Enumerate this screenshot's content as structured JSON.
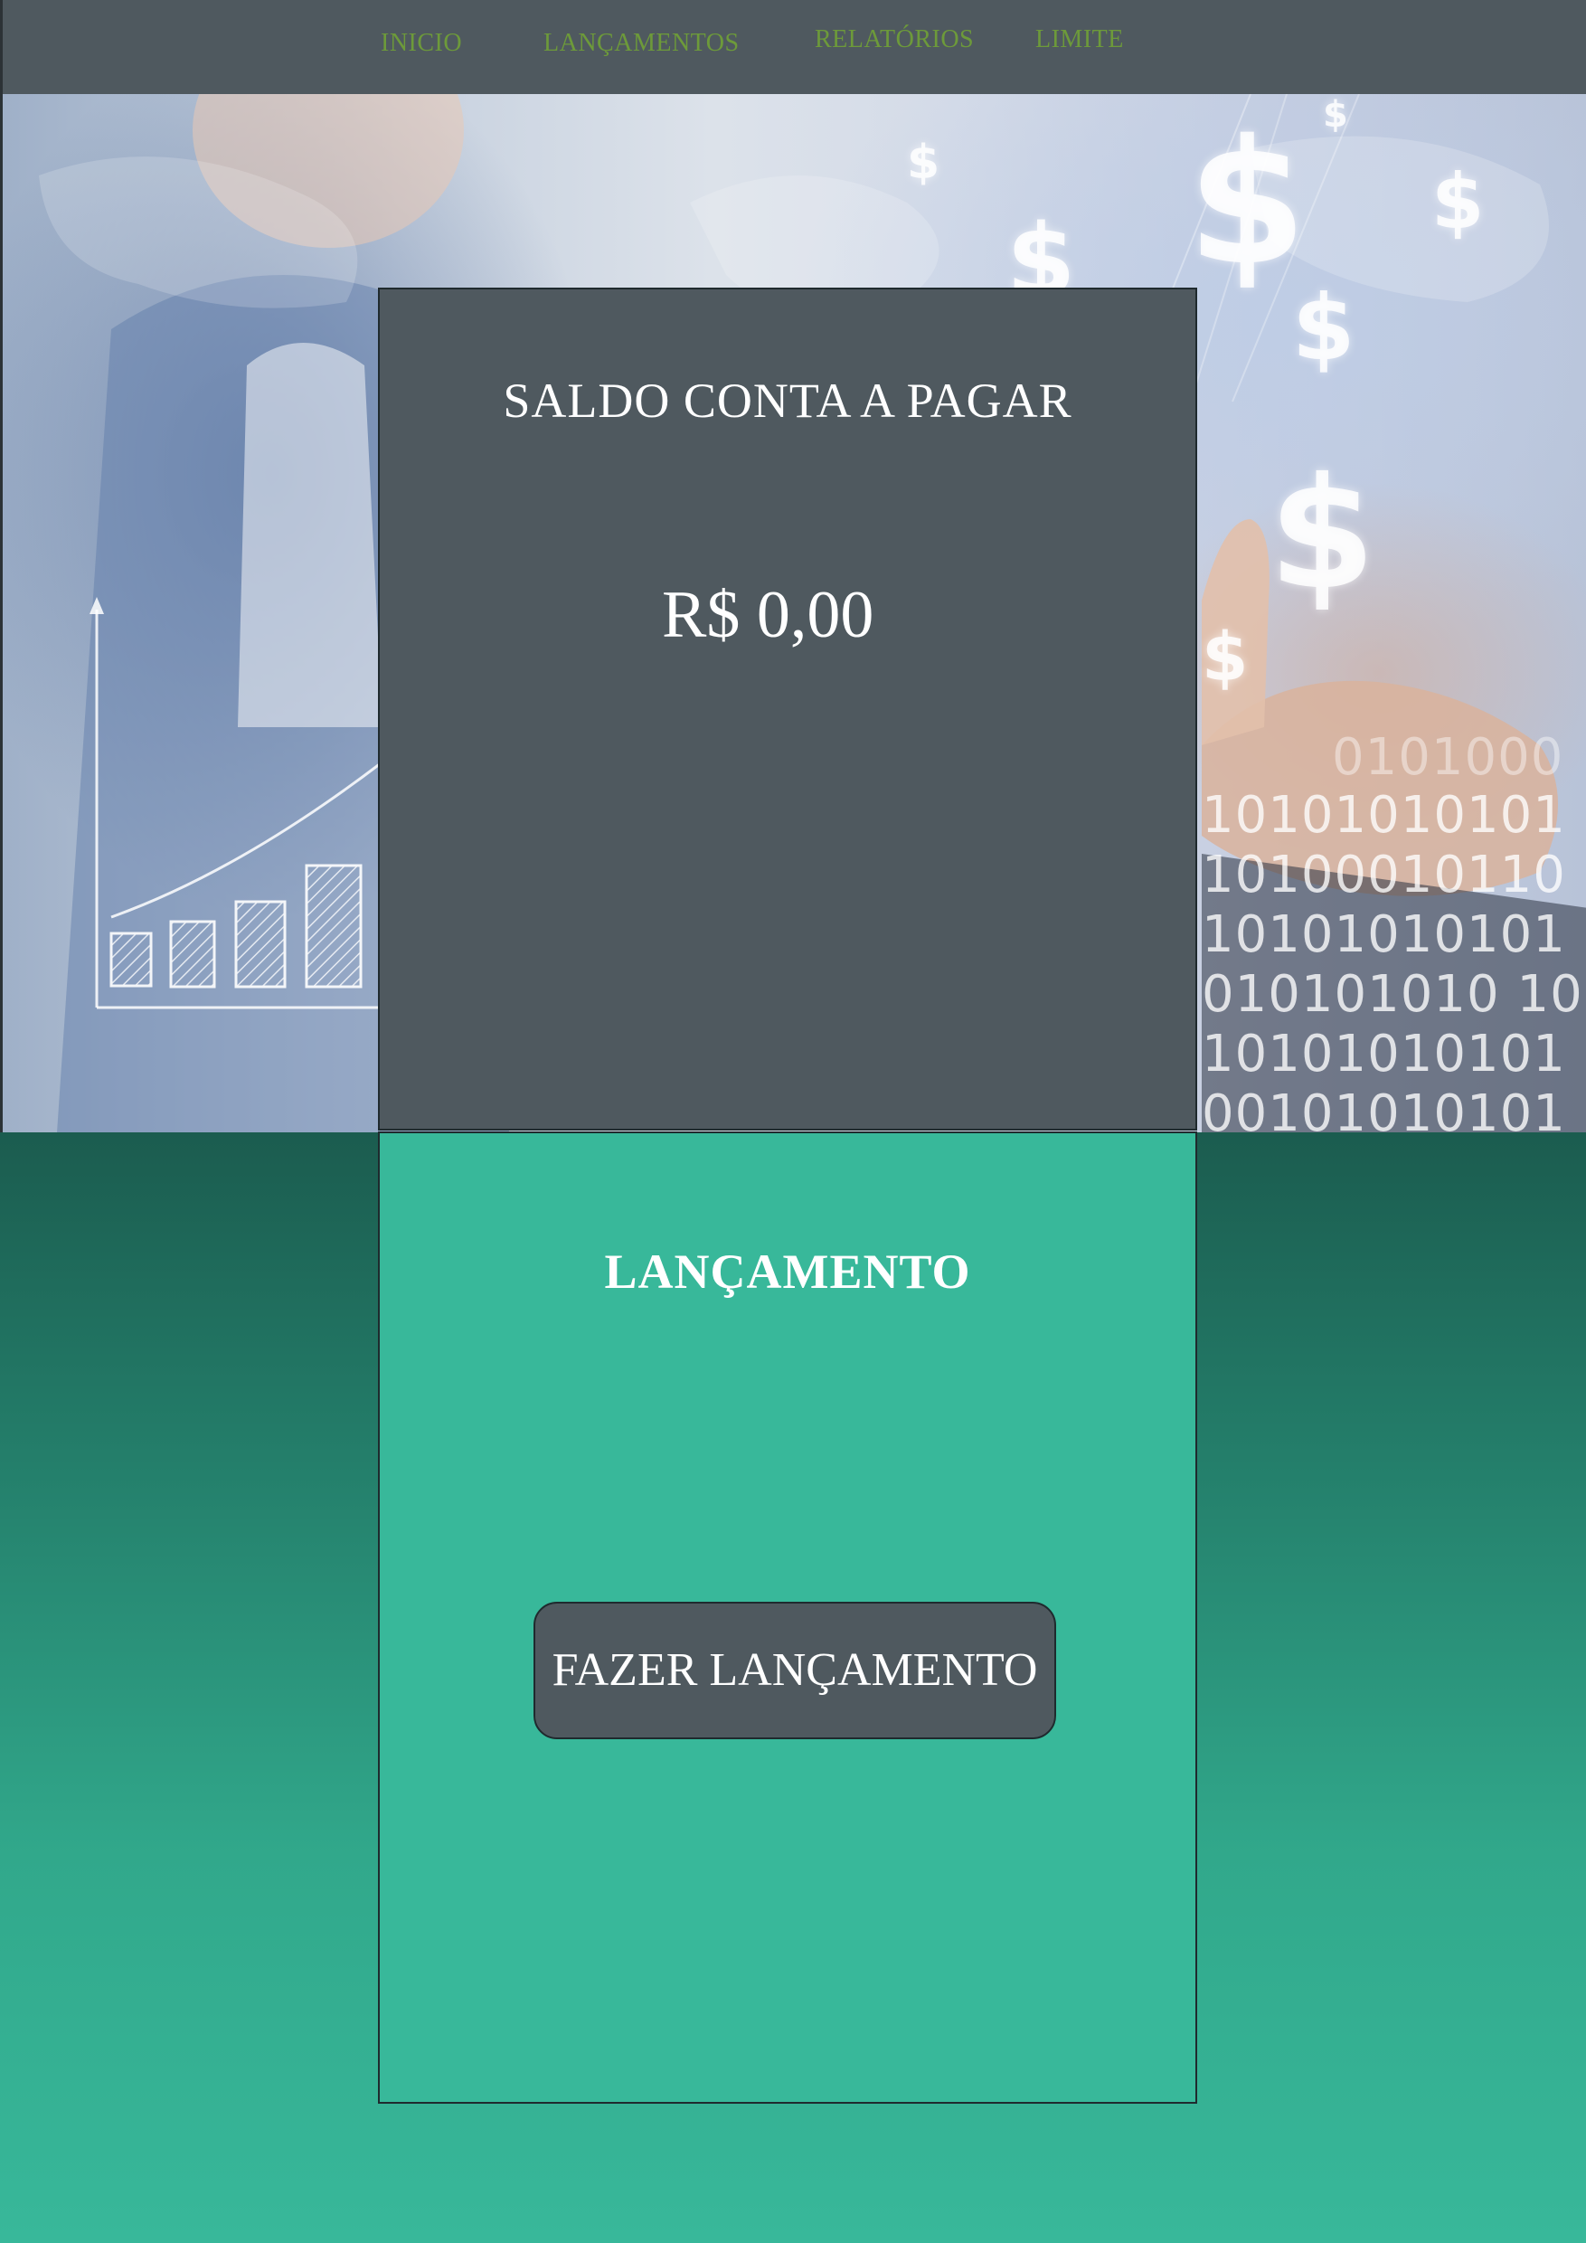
{
  "nav": {
    "items": [
      {
        "label": "INICIO"
      },
      {
        "label": "LANÇAMENTOS"
      },
      {
        "label": "RELATÓRIOS"
      },
      {
        "label": "LIMITE"
      }
    ]
  },
  "hero": {
    "dollar_symbol": "$",
    "binary_rows": [
      "0101000",
      "10101010101",
      "10100010110",
      "10101010101",
      "010101010 10",
      "10101010101",
      "00101010101"
    ]
  },
  "saldo": {
    "title": "SALDO CONTA A PAGAR",
    "value": "R$ 0,00"
  },
  "lancamento": {
    "title": "LANÇAMENTO",
    "button_label": "FAZER LANÇAMENTO"
  },
  "colors": {
    "nav_bg": "#4f595f",
    "nav_text": "#6d9a3a",
    "card_dark": "#4f595f",
    "card_teal": "#38b89a",
    "gradient_top": "#1b5c4f"
  }
}
